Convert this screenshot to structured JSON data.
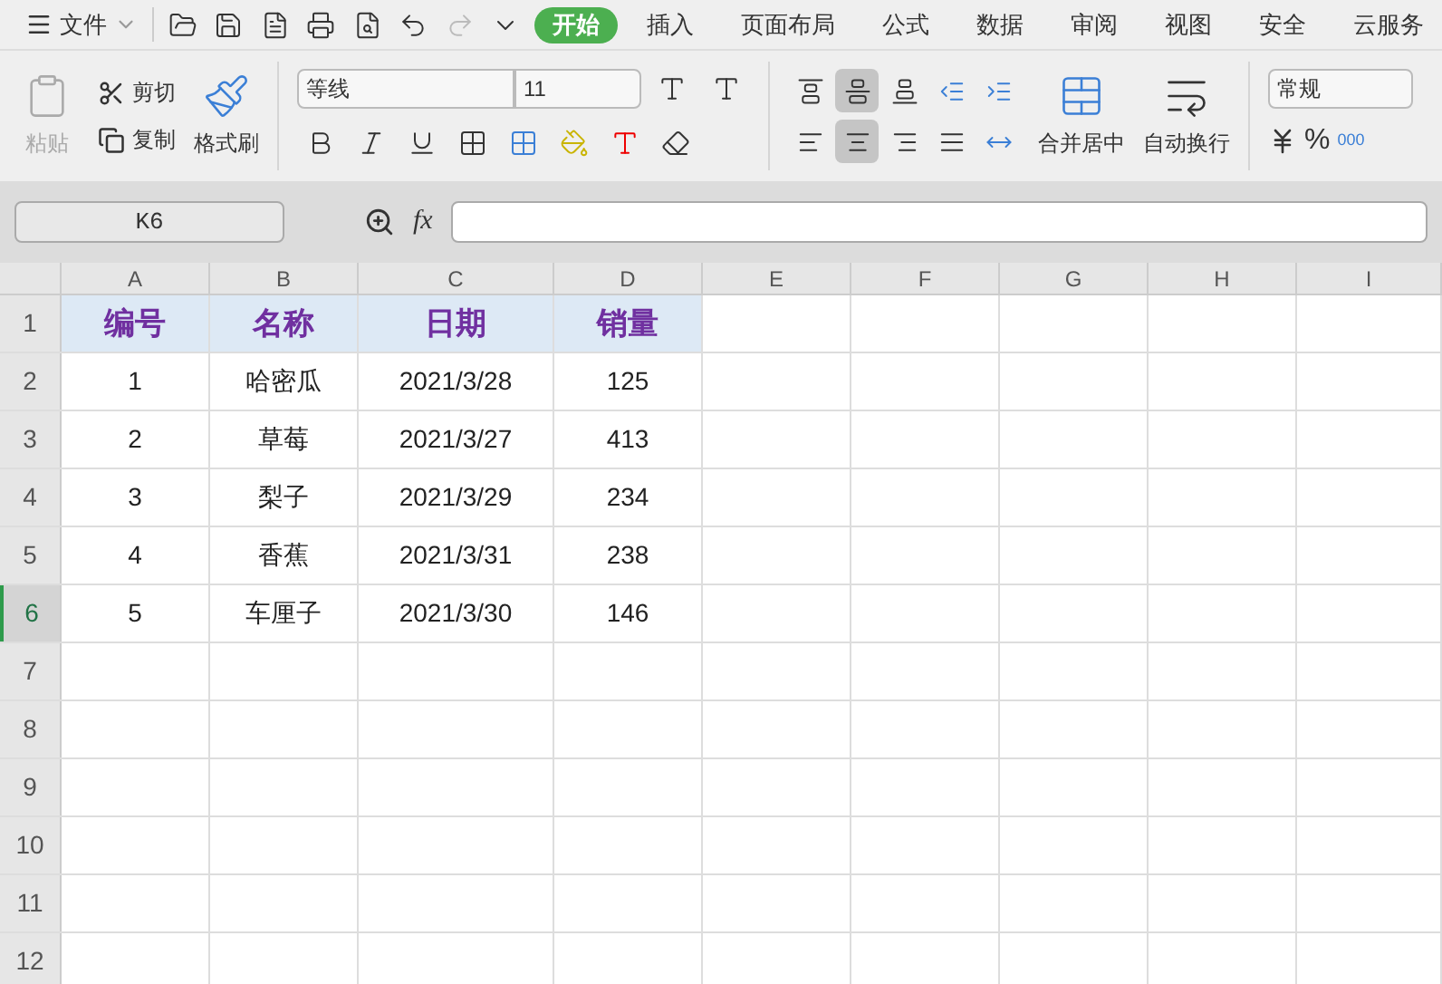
{
  "menu": {
    "file": "文件",
    "tabs": [
      {
        "label": "开始",
        "selected": true
      },
      {
        "label": "插入",
        "selected": false
      },
      {
        "label": "页面布局",
        "selected": false
      },
      {
        "label": "公式",
        "selected": false
      },
      {
        "label": "数据",
        "selected": false
      },
      {
        "label": "审阅",
        "selected": false
      },
      {
        "label": "视图",
        "selected": false
      },
      {
        "label": "安全",
        "selected": false
      },
      {
        "label": "云服务",
        "selected": false
      }
    ]
  },
  "ribbon": {
    "paste": {
      "label": "粘贴",
      "disabled": true
    },
    "cut": "剪切",
    "copy": "复制",
    "format_painter": "格式刷",
    "font": "等线",
    "font_size": "11",
    "align_top": [
      {
        "kind": "top",
        "selected": false
      },
      {
        "kind": "middle",
        "selected": true
      },
      {
        "kind": "bottom",
        "selected": false
      },
      {
        "kind": "outdent",
        "selected": false
      },
      {
        "kind": "indent",
        "selected": false
      }
    ],
    "align_bottom": [
      {
        "kind": "left",
        "selected": false
      },
      {
        "kind": "center",
        "selected": true
      },
      {
        "kind": "right",
        "selected": false
      },
      {
        "kind": "justify",
        "selected": false
      },
      {
        "kind": "distributed",
        "selected": false
      }
    ],
    "merge": "合并居中",
    "wrap": "自动换行",
    "number_format": "常规",
    "percent": "%",
    "thousands": "000"
  },
  "formula_bar": {
    "name_box": "K6",
    "fx": "fx"
  },
  "sheet": {
    "columns": [
      "A",
      "B",
      "C",
      "D",
      "E",
      "F",
      "G",
      "H",
      "I"
    ],
    "rows": [
      {
        "number": "1",
        "selected": false,
        "cells": [
          "编号",
          "名称",
          "日期",
          "销量"
        ]
      },
      {
        "number": "2",
        "selected": false,
        "cells": [
          "1",
          "哈密瓜",
          "2021/3/28",
          "125"
        ]
      },
      {
        "number": "3",
        "selected": false,
        "cells": [
          "2",
          "草莓",
          "2021/3/27",
          "413"
        ]
      },
      {
        "number": "4",
        "selected": false,
        "cells": [
          "3",
          "梨子",
          "2021/3/29",
          "234"
        ]
      },
      {
        "number": "5",
        "selected": false,
        "cells": [
          "4",
          "香蕉",
          "2021/3/31",
          "238"
        ]
      },
      {
        "number": "6",
        "selected": true,
        "cells": [
          "5",
          "车厘子",
          "2021/3/30",
          "146"
        ]
      },
      {
        "number": "7",
        "selected": false,
        "cells": []
      },
      {
        "number": "8",
        "selected": false,
        "cells": []
      },
      {
        "number": "9",
        "selected": false,
        "cells": []
      },
      {
        "number": "10",
        "selected": false,
        "cells": []
      },
      {
        "number": "11",
        "selected": false,
        "cells": []
      },
      {
        "number": "12",
        "selected": false,
        "cells": []
      }
    ]
  }
}
